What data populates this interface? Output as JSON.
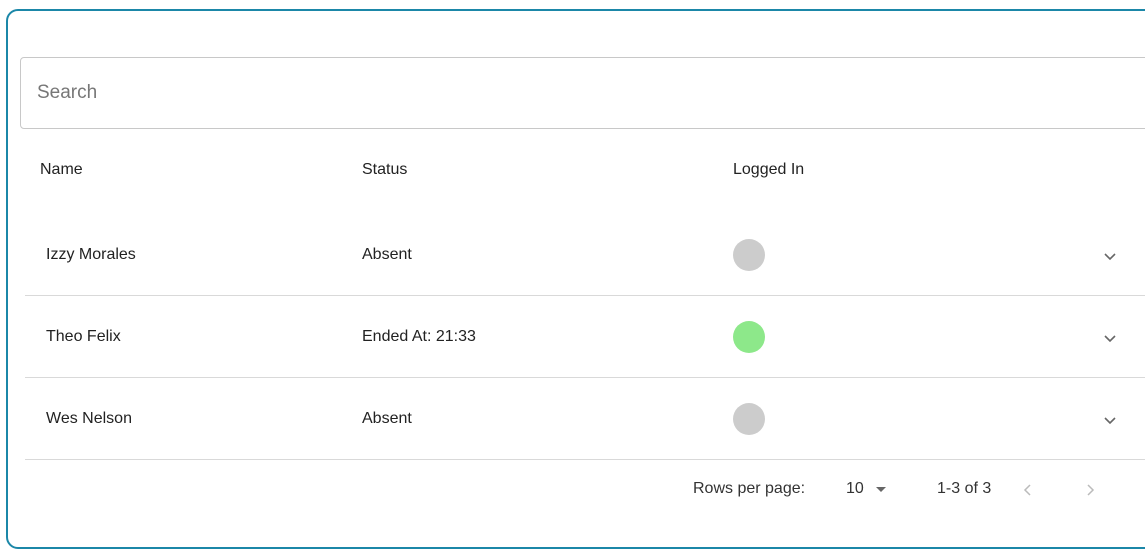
{
  "search": {
    "placeholder": "Search",
    "value": ""
  },
  "table": {
    "columns": [
      "Name",
      "Status",
      "Logged In"
    ],
    "rows": [
      {
        "name": "Izzy Morales",
        "status": "Absent",
        "logged_in": false,
        "dot_color": "#cccccc"
      },
      {
        "name": "Theo Felix",
        "status": "Ended At: 21:33",
        "logged_in": true,
        "dot_color": "#8de88a"
      },
      {
        "name": "Wes Nelson",
        "status": "Absent",
        "logged_in": false,
        "dot_color": "#cccccc"
      }
    ]
  },
  "pagination": {
    "rows_per_page_label": "Rows per page:",
    "rows_per_page_value": "10",
    "range_label": "1-3 of 3"
  },
  "colors": {
    "frame_border": "#1b87a8",
    "absent_dot": "#cccccc",
    "present_dot": "#8de88a"
  },
  "icons": {
    "row_expand": "chevron-down-icon",
    "prev_page": "chevron-left-icon",
    "next_page": "chevron-right-icon",
    "rows_per_page_caret": "caret-down-icon"
  }
}
